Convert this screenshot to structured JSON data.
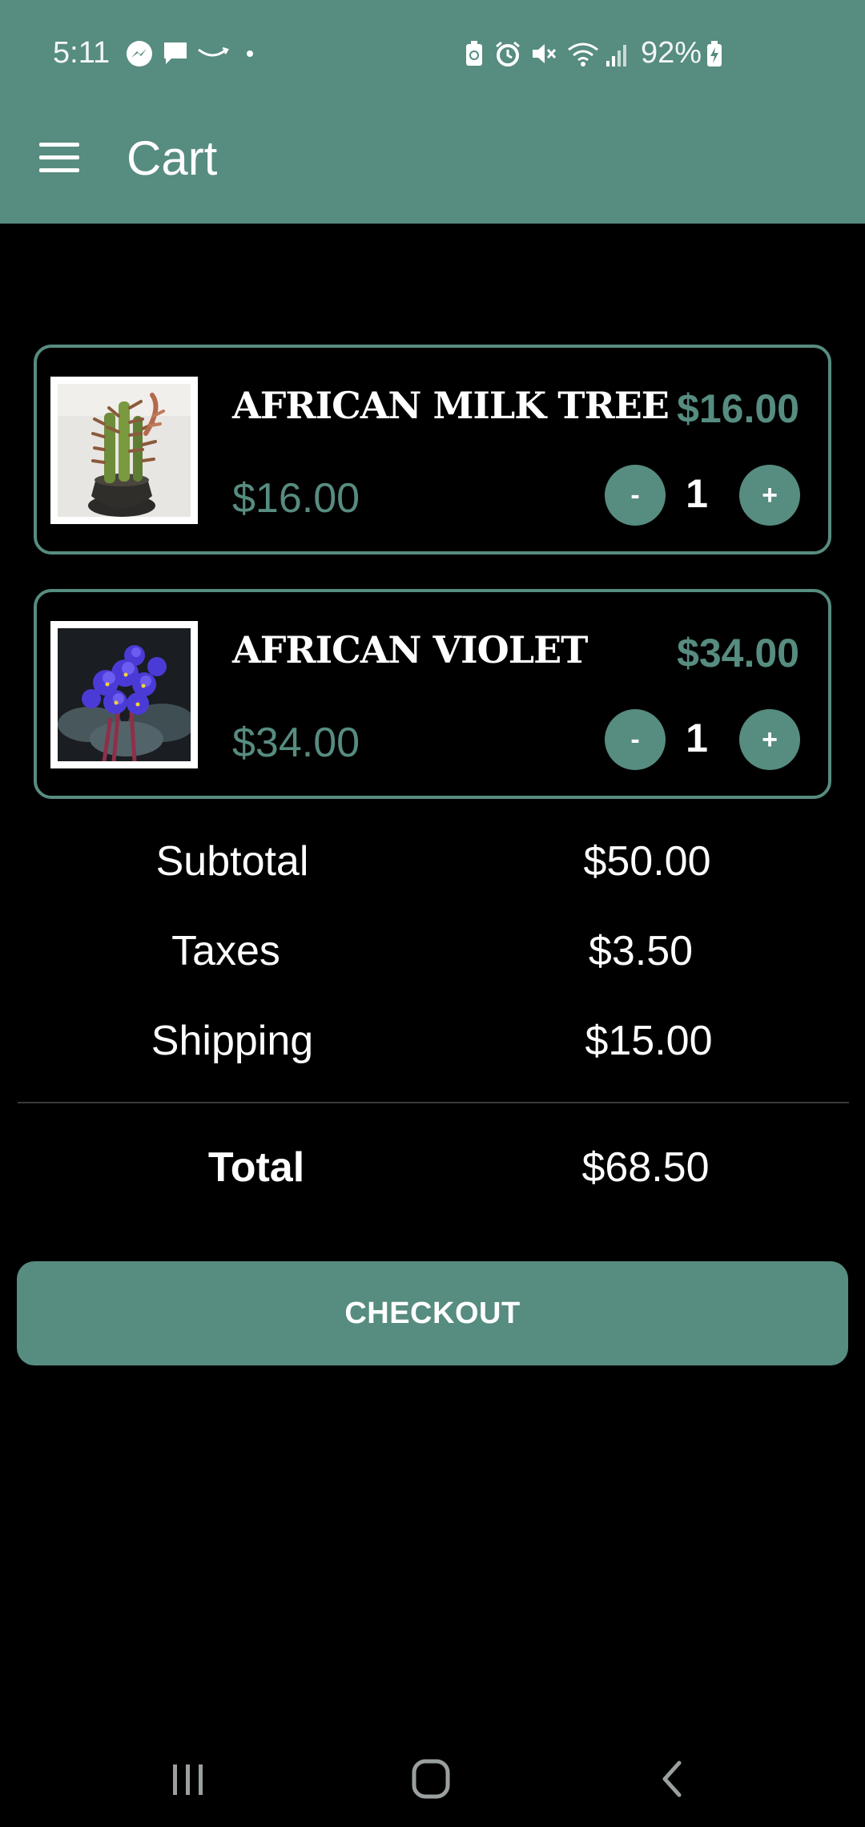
{
  "status_bar": {
    "time": "5:11",
    "battery_percent": "92%",
    "icons": [
      "messenger-icon",
      "chat-bubble-icon",
      "amazon-smile-icon",
      "dot-icon",
      "battery-saver-icon",
      "alarm-icon",
      "mute-icon",
      "wifi-icon",
      "signal-icon",
      "battery-charging-icon"
    ]
  },
  "app_bar": {
    "title": "Cart",
    "menu_icon": "hamburger-menu-icon"
  },
  "cart": {
    "items": [
      {
        "name": "AFRICAN MILK TREE",
        "price": "$16.00",
        "total": "$16.00",
        "quantity": "1",
        "image": "african-milk-tree-photo"
      },
      {
        "name": "AFRICAN VIOLET",
        "price": "$34.00",
        "total": "$34.00",
        "quantity": "1",
        "image": "african-violet-photo"
      }
    ],
    "decrement_label": "-",
    "increment_label": "+"
  },
  "summary": {
    "subtotal_label": "Subtotal",
    "subtotal_value": "$50.00",
    "taxes_label": "Taxes",
    "taxes_value": "$3.50",
    "shipping_label": "Shipping",
    "shipping_value": "$15.00",
    "total_label": "Total",
    "total_value": "$68.50"
  },
  "checkout_label": "CHECKOUT",
  "nav_bar": [
    "recent-apps-icon",
    "home-icon",
    "back-icon"
  ],
  "colors": {
    "accent": "#578c80",
    "background": "#000000",
    "text": "#ffffff"
  }
}
